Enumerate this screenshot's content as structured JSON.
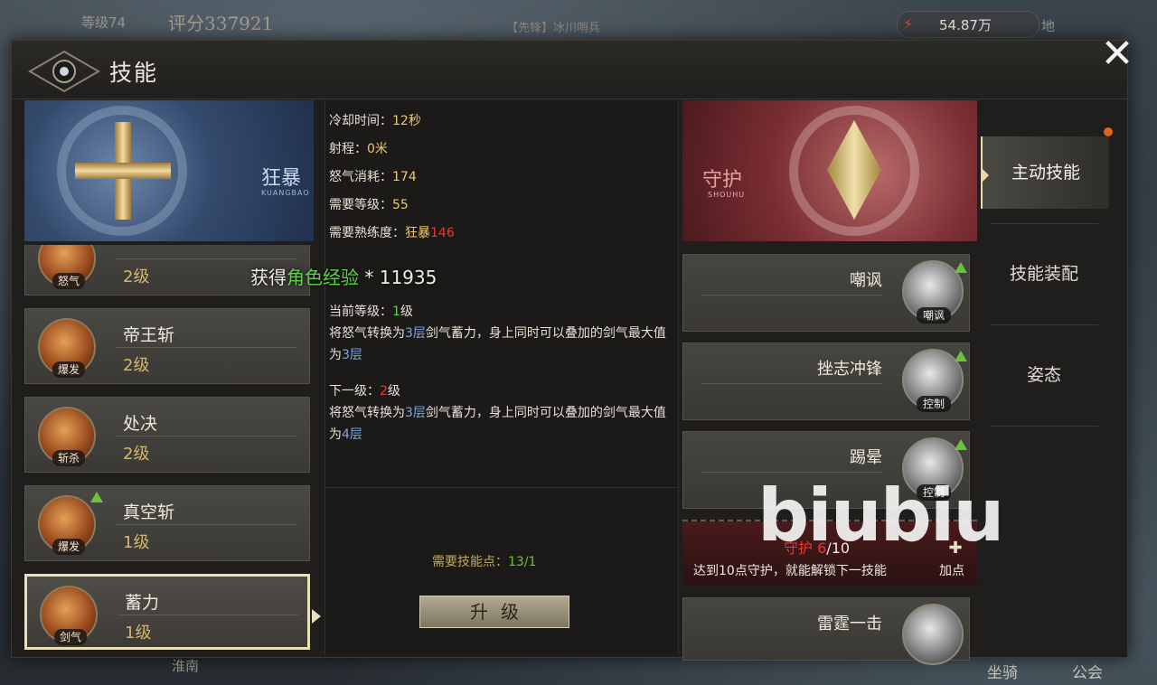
{
  "hud": {
    "level": "等级74",
    "power": "评分337921",
    "team": "【先锋】冰川哨兵",
    "gold": "54.87万",
    "map": "地",
    "bottom_left": "淮南",
    "mount": "坐骑",
    "guild": "公会"
  },
  "panel": {
    "title": "技能"
  },
  "left_banner": {
    "name": "狂暴",
    "name_sub": "KUANGBAO"
  },
  "xp_gain": {
    "prefix": "获得",
    "highlight": "角色经验",
    "suffix": " * 11935"
  },
  "skills": [
    {
      "name": "",
      "level": "2级",
      "tag": "怒气",
      "upgradable": false,
      "selected": false
    },
    {
      "name": "帝王斩",
      "level": "2级",
      "tag": "爆发",
      "upgradable": false,
      "selected": false
    },
    {
      "name": "处决",
      "level": "2级",
      "tag": "斩杀",
      "upgradable": false,
      "selected": false
    },
    {
      "name": "真空斩",
      "level": "1级",
      "tag": "爆发",
      "upgradable": true,
      "selected": false
    },
    {
      "name": "蓄力",
      "level": "1级",
      "tag": "剑气",
      "upgradable": false,
      "selected": true
    }
  ],
  "detail": {
    "cooldown_label": "冷却时间：",
    "cooldown": "12秒",
    "range_label": "射程：",
    "range": "0米",
    "rage_label": "怒气消耗：",
    "rage": "174",
    "req_level_label": "需要等级：",
    "req_level": "55",
    "req_prof_label": "需要熟练度：",
    "req_prof_branch": "狂暴",
    "req_prof_value": "146",
    "current_label": "当前等级：",
    "current_level": "1",
    "current_level_unit": "级",
    "current_desc_a": "将怒气转换为",
    "current_desc_b": "3层",
    "current_desc_c": "剑气蓄力，身上同时可以叠加的剑气最大值为",
    "current_desc_d": "3层",
    "next_label": "下一级：",
    "next_level": "2",
    "next_level_unit": "级",
    "next_desc_a": "将怒气转换为",
    "next_desc_b": "3层",
    "next_desc_c": "剑气蓄力，身上同时可以叠加的剑气最大值为",
    "next_desc_d": "4层",
    "req_points_label": "需要技能点：",
    "req_points": "13/1",
    "upgrade_button": "升级"
  },
  "right_banner": {
    "name": "守护",
    "name_sub": "SHOUHU"
  },
  "right_skills": [
    {
      "name": "嘲讽",
      "tag": "嘲讽",
      "upgradable": true
    },
    {
      "name": "挫志冲锋",
      "tag": "控制",
      "upgradable": true
    },
    {
      "name": "踢晕",
      "tag": "控制",
      "upgradable": true
    },
    {
      "name": "雷霆一击",
      "tag": "",
      "upgradable": false
    }
  ],
  "unlock": {
    "progress_label": "守护",
    "progress_current": "6",
    "progress_total": "/10",
    "text": "达到10点守护，就能解锁下一技能",
    "add_points": "加点"
  },
  "tabs": [
    {
      "label": "主动技能",
      "active": true
    },
    {
      "label": "技能装配",
      "active": false
    },
    {
      "label": "姿态",
      "active": false
    }
  ],
  "watermark": "biubiu",
  "colors": {
    "gold": "#f2c96a",
    "green": "#5fd14a",
    "red": "#e23b2f",
    "blue": "#79a7e4"
  }
}
